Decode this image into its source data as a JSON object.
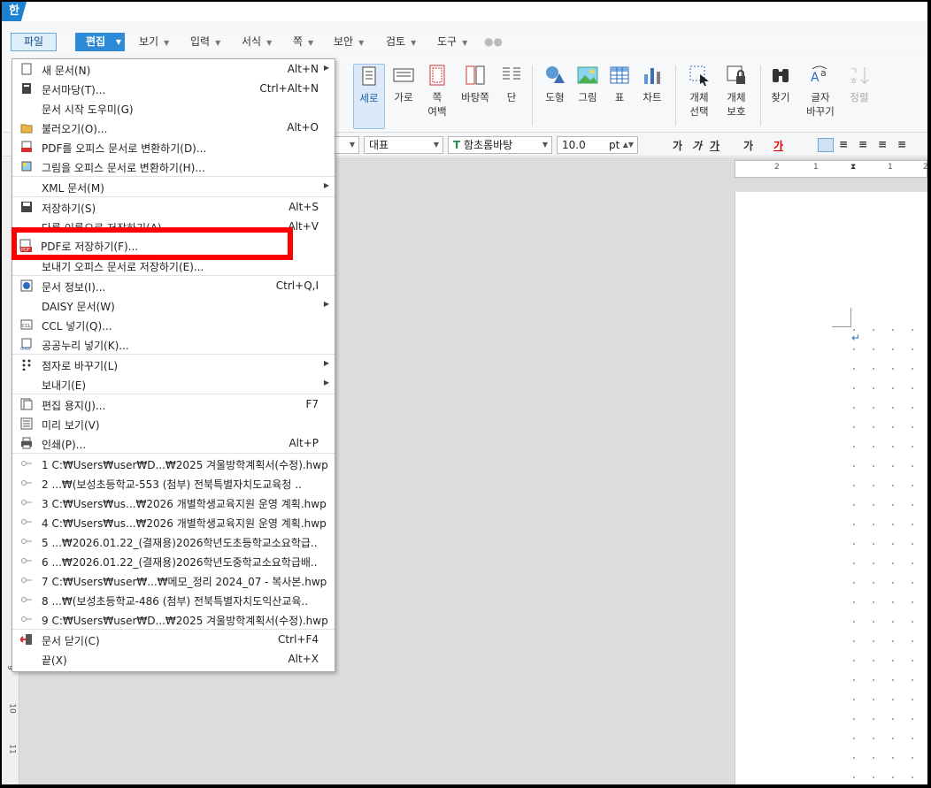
{
  "app": {
    "logo": "한"
  },
  "menubar": {
    "file": "파일",
    "edit": "편집",
    "items": [
      "보기",
      "입력",
      "서식",
      "쪽",
      "보안",
      "검토",
      "도구"
    ]
  },
  "ribbon": {
    "buttons": [
      "세로",
      "가로",
      "쪽\n여백",
      "바탕쪽",
      "단",
      "도형",
      "그림",
      "표",
      "차트",
      "개체\n선택",
      "개체\n보호",
      "찾기",
      "글자\n바꾸기",
      "정렬"
    ]
  },
  "format": {
    "style": "대표",
    "font": "함초롬바탕",
    "size": "10.0",
    "unit": "pt"
  },
  "ruler": {
    "h": [
      "2",
      "1",
      "1",
      "2"
    ],
    "v": [
      "9",
      "10",
      "11"
    ]
  },
  "file_menu": {
    "items": [
      {
        "label": "새 문서(N)",
        "shortcut": "Alt+N",
        "submenu": true,
        "icon": "new-document-icon"
      },
      {
        "label": "문서마당(T)...",
        "shortcut": "Ctrl+Alt+N",
        "icon": "template-icon"
      },
      {
        "label": "문서 시작 도우미(G)",
        "shortcut": "",
        "icon": ""
      },
      {
        "label": "불러오기(O)...",
        "shortcut": "Alt+O",
        "icon": "open-folder-icon"
      },
      {
        "label": "PDF를 오피스 문서로 변환하기(D)...",
        "shortcut": "",
        "icon": "pdf-icon"
      },
      {
        "label": "그림을 오피스 문서로 변환하기(H)...",
        "shortcut": "",
        "icon": "image-convert-icon"
      },
      {
        "label": "XML 문서(M)",
        "shortcut": "",
        "submenu": true,
        "icon": ""
      },
      {
        "label": "저장하기(S)",
        "shortcut": "Alt+S",
        "icon": "save-icon"
      },
      {
        "label": "다른 이름으로 저장하기(A)...",
        "shortcut": "Alt+V",
        "icon": ""
      },
      {
        "label": "PDF로 저장하기(F)...",
        "shortcut": "",
        "icon": "pdf-save-icon"
      },
      {
        "label": "보내기 오피스 문서로 저장하기(E)...",
        "shortcut": "",
        "icon": ""
      },
      {
        "label": "문서 정보(I)...",
        "shortcut": "Ctrl+Q,I",
        "icon": "info-icon"
      },
      {
        "label": "DAISY 문서(W)",
        "shortcut": "",
        "submenu": true,
        "icon": ""
      },
      {
        "label": "CCL 넣기(Q)...",
        "shortcut": "",
        "icon": "ccl-icon"
      },
      {
        "label": "공공누리 넣기(K)...",
        "shortcut": "",
        "icon": "open-icon"
      },
      {
        "label": "점자로 바꾸기(L)",
        "shortcut": "",
        "submenu": true,
        "icon": "braille-icon"
      },
      {
        "label": "보내기(E)",
        "shortcut": "",
        "submenu": true,
        "icon": ""
      },
      {
        "label": "편집 용지(J)...",
        "shortcut": "F7",
        "icon": "page-setup-icon"
      },
      {
        "label": "미리 보기(V)",
        "shortcut": "",
        "icon": "preview-icon"
      },
      {
        "label": "인쇄(P)...",
        "shortcut": "Alt+P",
        "icon": "print-icon"
      }
    ],
    "recent": [
      "1 C:₩Users₩user₩D...₩2025 겨울방학계획서(수정).hwp",
      "2 ...₩(보성초등학교-553 (첨부) 전북특별자치도교육청 ..",
      "3 C:₩Users₩us...₩2026 개별학생교육지원 운영 계획.hwp",
      "4 C:₩Users₩us...₩2026 개별학생교육지원 운영 계획.hwp",
      "5 ...₩2026.01.22_(결재용)2026학년도초등학교소요학급..",
      "6 ...₩2026.01.22_(결재용)2026학년도중학교소요학급배..",
      "7 C:₩Users₩user₩...₩메모_정리 2024_07 - 복사본.hwp",
      "8 ...₩(보성초등학교-486 (첨부) 전북특별자치도익산교육..",
      "9 C:₩Users₩user₩D...₩2025 겨울방학계획서(수정).hwp"
    ],
    "close": {
      "label": "문서 닫기(C)",
      "shortcut": "Ctrl+F4"
    },
    "exit": {
      "label": "끝(X)",
      "shortcut": "Alt+X"
    }
  },
  "highlight_label": "PDF로 저장하기(F)...",
  "colors": {
    "accent": "#2d8ad6",
    "highlight": "#ff0000"
  }
}
